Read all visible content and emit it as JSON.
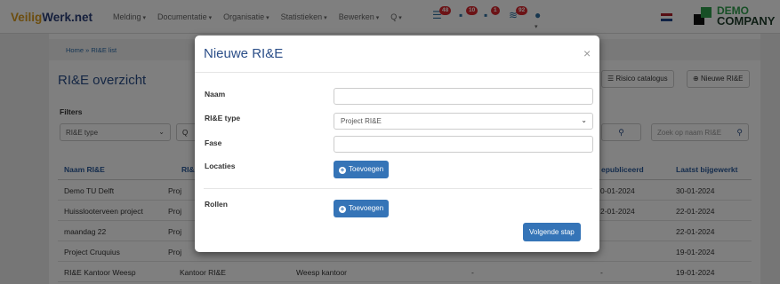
{
  "app": {
    "logo_part1": "Veilig",
    "logo_part2": "Werk.net",
    "nav": [
      "Melding",
      "Documentatie",
      "Organisatie",
      "Statistieken",
      "Bewerken",
      "Q"
    ],
    "badges": [
      "48",
      "10",
      "1",
      "92"
    ],
    "company_line1": "DEMO",
    "company_line2": "COMPANY",
    "brand_colors": {
      "primary": "#2b4e88",
      "accent": "#d89a1e",
      "button": "#3574b7",
      "badge": "#d9262c"
    }
  },
  "background": {
    "breadcrumb": "Home » RI&E list",
    "title": "RI&E overzicht",
    "risk_catalog_button": "Risico catalogus",
    "new_rie_button": "Nieuwe RI&E",
    "filters_label": "Filters",
    "type_filter_value": "RI&E type",
    "type_filter_fragment": "Q",
    "search_placeholder": "Zoek op naam RI&E",
    "table_headers": [
      "Naam RI&E",
      "RI&",
      "epubliceerd",
      "Laatst bijgewerkt"
    ],
    "rows": [
      {
        "name": "Demo TU Delft",
        "type": "Proj",
        "location": "",
        "fase": "",
        "published": "0-01-2024",
        "updated": "30-01-2024"
      },
      {
        "name": "Huisslooterveen project",
        "type": "Proj",
        "location": "",
        "fase": "",
        "published": "2-01-2024",
        "updated": "22-01-2024"
      },
      {
        "name": "maandag 22",
        "type": "Proj",
        "location": "",
        "fase": "",
        "published": "",
        "updated": "22-01-2024"
      },
      {
        "name": "Project Cruquius",
        "type": "Proj",
        "location": "",
        "fase": "",
        "published": "",
        "updated": "19-01-2024"
      },
      {
        "name": "RI&E Kantoor Weesp",
        "type": "Kantoor RI&E",
        "location": "Weesp kantoor",
        "fase": "-",
        "published": "-",
        "updated": "19-01-2024"
      }
    ]
  },
  "modal": {
    "title": "Nieuwe RI&E",
    "close": "×",
    "naam_label": "Naam",
    "naam_value": "",
    "type_label": "RI&E type",
    "type_value": "Project RI&E",
    "fase_label": "Fase",
    "fase_value": "",
    "locaties_label": "Locaties",
    "locaties_button": "Toevoegen",
    "rollen_label": "Rollen",
    "rollen_button": "Toevoegen",
    "next_button": "Volgende stap"
  }
}
